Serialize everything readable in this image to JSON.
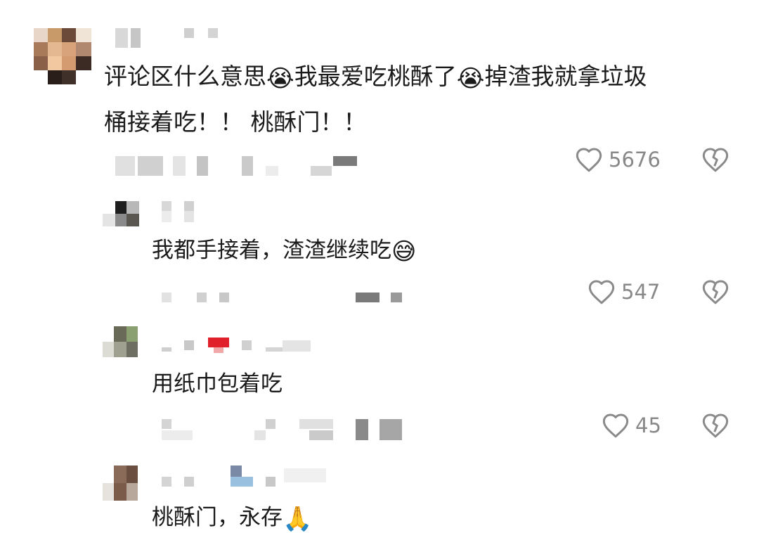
{
  "comments": [
    {
      "text_part1": "评论区什么意思",
      "emoji1": "😭",
      "text_part2": "我最爱吃桃酥了",
      "emoji2": "😭",
      "text_part3": "掉渣我就拿垃圾",
      "text_line2": "桶接着吃！！ 桃酥门！！",
      "likes": "5676"
    }
  ],
  "replies": [
    {
      "text": "我都手接着，渣渣继续吃",
      "emoji": "😅",
      "likes": "547"
    },
    {
      "text": "用纸巾包着吃",
      "likes": "45"
    },
    {
      "text": "桃酥门，永存",
      "emoji": "🙏"
    }
  ],
  "icons": {
    "like": "heart-outline-icon",
    "dislike": "broken-heart-icon"
  },
  "colors": {
    "icon_gray": "#8a8a8a",
    "text": "#1a1a1a",
    "blur_red": "#e0202a"
  }
}
